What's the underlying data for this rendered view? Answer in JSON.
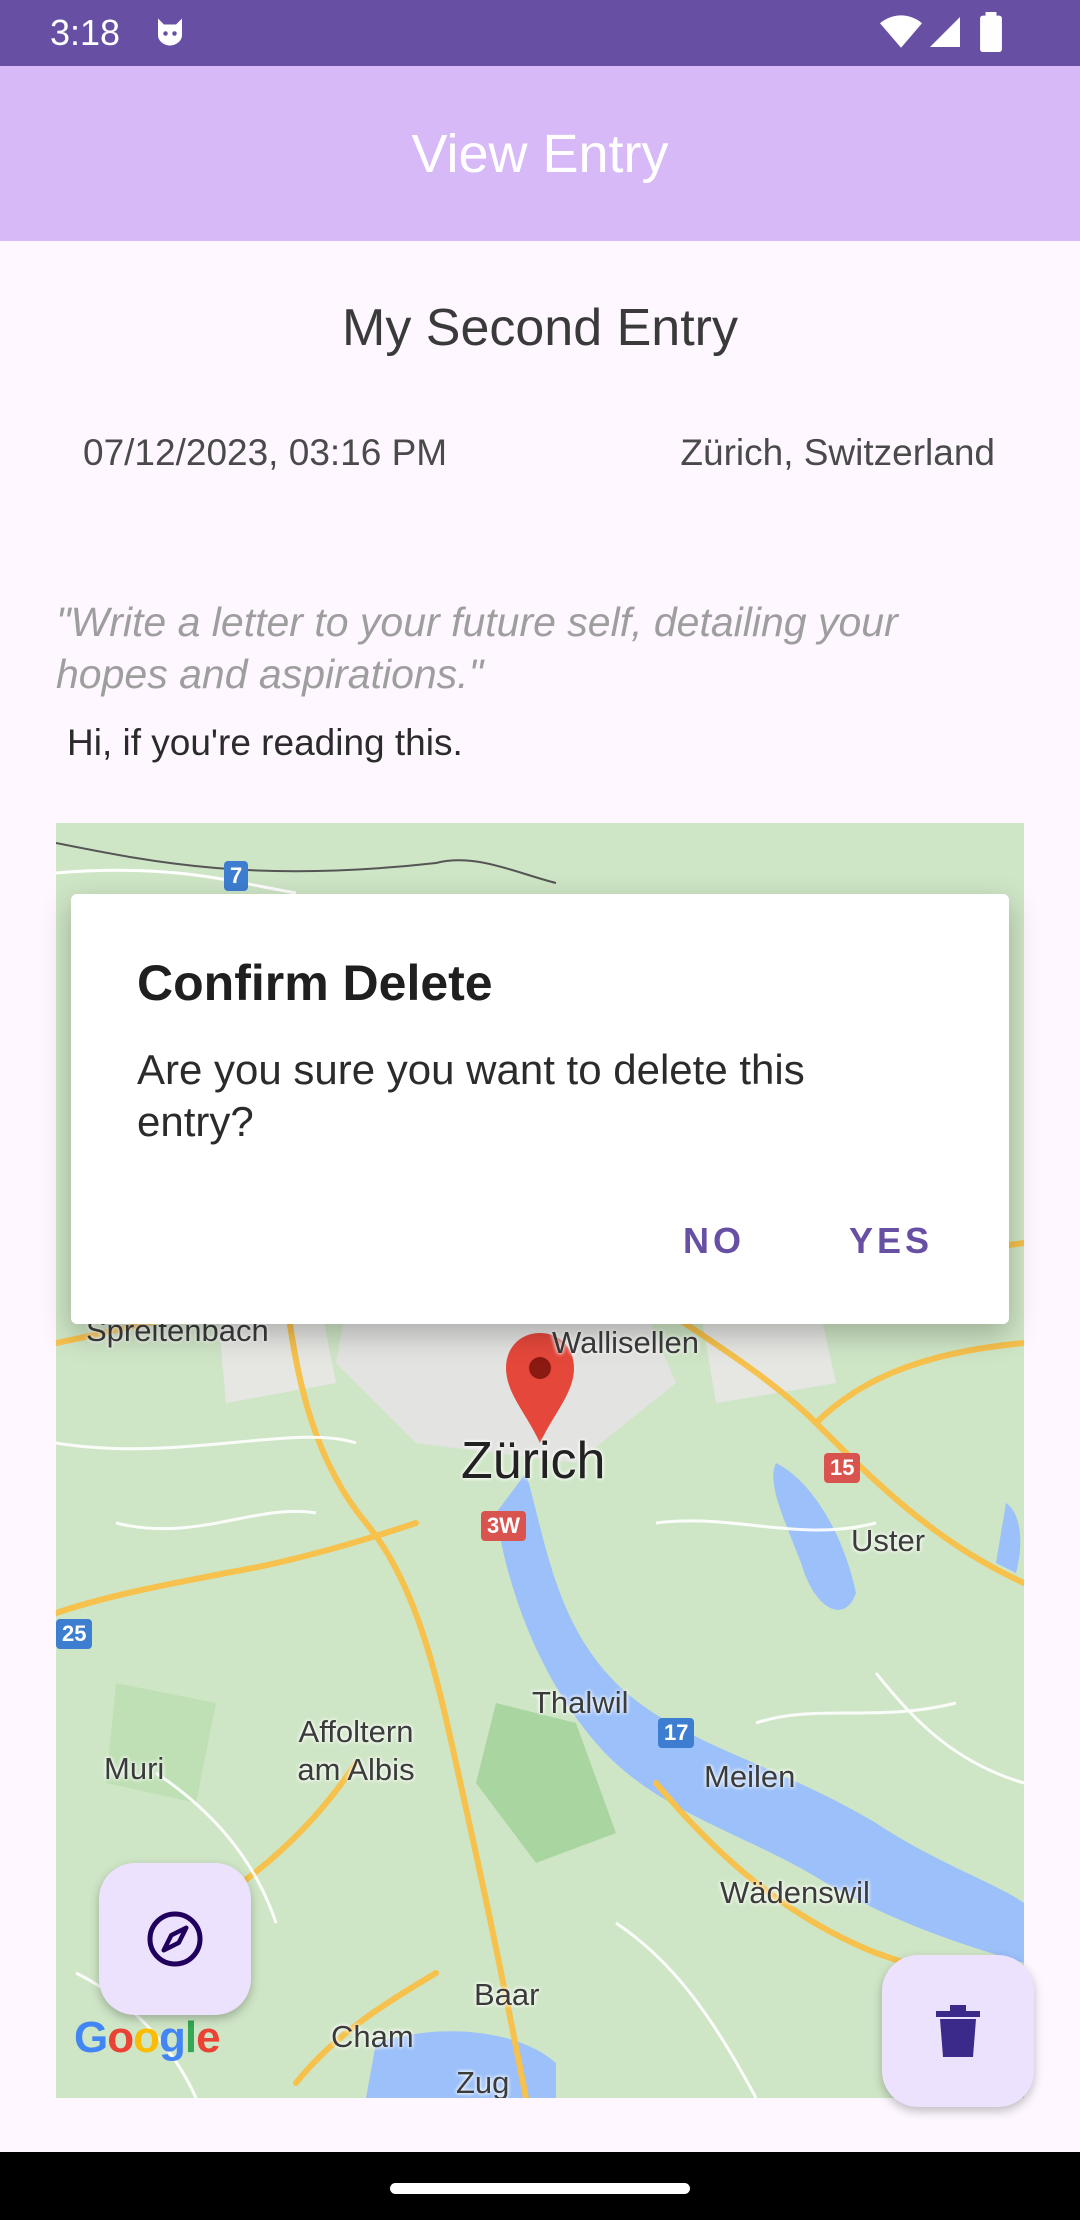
{
  "status_bar": {
    "time": "3:18",
    "icons": [
      "cat-icon",
      "wifi-icon",
      "signal-icon",
      "battery-icon"
    ]
  },
  "app_bar": {
    "title": "View Entry",
    "background": "#d8b9f7"
  },
  "entry": {
    "title": "My Second Entry",
    "date": "07/12/2023, 03:16 PM",
    "location": "Zürich, Switzerland",
    "prompt": "\"Write a letter to your future self, detailing your hopes and aspirations.\"",
    "body": "Hi, if you're reading this."
  },
  "map": {
    "labels": {
      "zurich": "Zürich",
      "wallisellen": "Wallisellen",
      "spreitenbach": "Spreitenbach",
      "uster": "Uster",
      "thalwil": "Thalwil",
      "affoltern": "Affoltern am Albis",
      "muri": "Muri",
      "meilen": "Meilen",
      "wadenswil": "Wädenswil",
      "baar": "Baar",
      "cham": "Cham",
      "zug": "Zug"
    },
    "shields": {
      "s7": "7",
      "s3w": "3W",
      "s15": "15",
      "s17": "17",
      "s25": "25"
    },
    "google": [
      "G",
      "o",
      "o",
      "g",
      "l",
      "e"
    ],
    "colors": {
      "land": "#cfe6c6",
      "water": "#9cc0f9",
      "road": "#f6c14c",
      "pin": "#e5483b"
    }
  },
  "dialog": {
    "title": "Confirm Delete",
    "message": "Are you sure you want to delete this entry?",
    "no_label": "NO",
    "yes_label": "YES",
    "accent": "#6750a4"
  },
  "fabs": {
    "compass": "compass-icon",
    "delete": "trash-icon"
  }
}
